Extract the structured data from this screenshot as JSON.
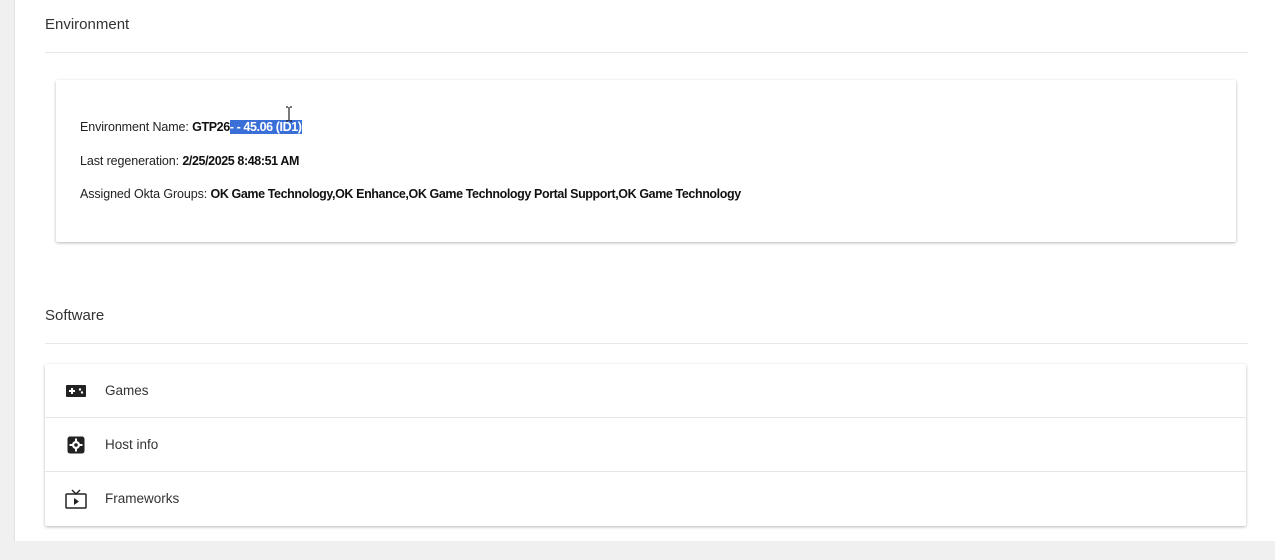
{
  "environment": {
    "section_title": "Environment",
    "name_label": "Environment Name: ",
    "name_value_part1": "GTP26",
    "name_value_selected": "- - 45.06 (ID1)",
    "regen_label": "Last regeneration: ",
    "regen_value": "2/25/2025 8:48:51 AM",
    "okta_label": "Assigned Okta Groups: ",
    "okta_value": "OK Game Technology,OK Enhance,OK Game Technology Portal Support,OK Game Technology"
  },
  "software": {
    "section_title": "Software",
    "items": [
      {
        "label": "Games",
        "icon": "gamepad-icon"
      },
      {
        "label": "Host info",
        "icon": "host-settings-icon"
      },
      {
        "label": "Frameworks",
        "icon": "tv-play-icon"
      }
    ]
  },
  "colors": {
    "selection": "#3a6fd8",
    "background": "#f0f0f0",
    "card": "#ffffff"
  }
}
